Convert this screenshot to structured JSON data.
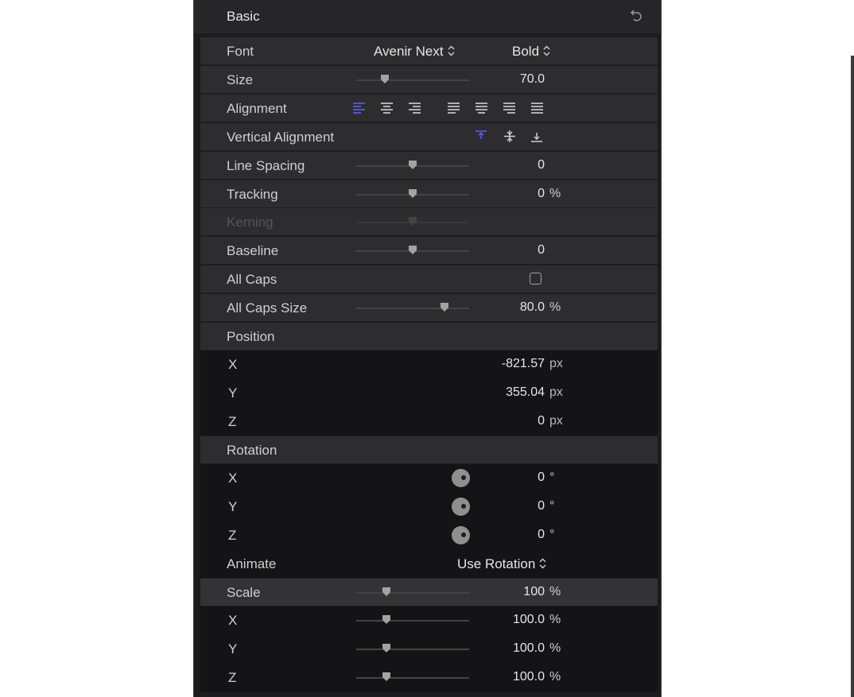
{
  "header": {
    "title": "Basic"
  },
  "font": {
    "label": "Font",
    "family": "Avenir Next",
    "weight": "Bold"
  },
  "size": {
    "label": "Size",
    "value": "70.0",
    "slider_fraction": 0.25
  },
  "alignment": {
    "label": "Alignment",
    "options": [
      "align-left",
      "align-center",
      "align-right",
      "justify-left",
      "justify-center",
      "justify-right",
      "justify-full"
    ],
    "selected": "align-left"
  },
  "vertical_alignment": {
    "label": "Vertical Alignment",
    "options": [
      "align-top",
      "align-middle",
      "align-bottom"
    ],
    "selected": "align-top"
  },
  "line_spacing": {
    "label": "Line Spacing",
    "value": "0",
    "slider_fraction": 0.5
  },
  "tracking": {
    "label": "Tracking",
    "value": "0",
    "unit": "%",
    "slider_fraction": 0.5
  },
  "kerning": {
    "label": "Kerning",
    "enabled": false,
    "slider_fraction": 0.5
  },
  "baseline": {
    "label": "Baseline",
    "value": "0",
    "slider_fraction": 0.5
  },
  "all_caps": {
    "label": "All Caps",
    "checked": false
  },
  "all_caps_size": {
    "label": "All Caps Size",
    "value": "80.0",
    "unit": "%",
    "slider_fraction": 0.78
  },
  "position": {
    "label": "Position",
    "x": {
      "label": "X",
      "value": "-821.57",
      "unit": "px"
    },
    "y": {
      "label": "Y",
      "value": "355.04",
      "unit": "px"
    },
    "z": {
      "label": "Z",
      "value": "0",
      "unit": "px"
    }
  },
  "rotation": {
    "label": "Rotation",
    "x": {
      "label": "X",
      "value": "0",
      "unit": "°"
    },
    "y": {
      "label": "Y",
      "value": "0",
      "unit": "°"
    },
    "z": {
      "label": "Z",
      "value": "0",
      "unit": "°"
    },
    "animate": {
      "label": "Animate",
      "value": "Use Rotation"
    }
  },
  "scale": {
    "label": "Scale",
    "value": "100",
    "unit": "%",
    "slider_fraction": 0.27,
    "x": {
      "label": "X",
      "value": "100.0",
      "unit": "%",
      "slider_fraction": 0.27
    },
    "y": {
      "label": "Y",
      "value": "100.0",
      "unit": "%",
      "slider_fraction": 0.27
    },
    "z": {
      "label": "Z",
      "value": "100.0",
      "unit": "%",
      "slider_fraction": 0.27
    }
  },
  "colors": {
    "panel": "#1c1c1e",
    "row": "#2d2d2f",
    "dark_group": "#141416",
    "accent": "#5b5bff",
    "text": "#d0d0d0"
  }
}
